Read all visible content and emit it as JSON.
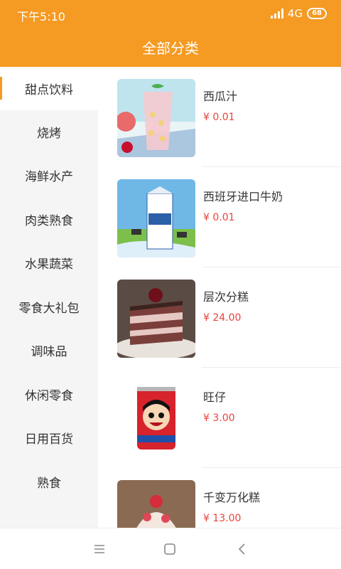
{
  "status_bar": {
    "time": "下午5:10",
    "network": "4G",
    "battery": "68"
  },
  "header": {
    "title": "全部分类"
  },
  "categories": [
    {
      "label": "甜点饮料",
      "active": true
    },
    {
      "label": "烧烤"
    },
    {
      "label": "海鲜水产"
    },
    {
      "label": "肉类熟食"
    },
    {
      "label": "水果蔬菜"
    },
    {
      "label": "零食大礼包"
    },
    {
      "label": "调味品"
    },
    {
      "label": "休闲零食"
    },
    {
      "label": "日用百货"
    },
    {
      "label": "熟食"
    }
  ],
  "products": [
    {
      "name": "西瓜汁",
      "price": "¥ 0.01",
      "image": "watermelon-juice"
    },
    {
      "name": "西班牙进口牛奶",
      "price": "¥ 0.01",
      "image": "milk-carton"
    },
    {
      "name": "层次分糕",
      "price": "¥ 24.00",
      "image": "layer-cake"
    },
    {
      "name": "旺仔",
      "price": "¥ 3.00",
      "image": "wangzai-can"
    },
    {
      "name": "千变万化糕",
      "price": "¥ 13.00",
      "image": "cream-cake"
    }
  ],
  "nav_bar": {
    "icons": [
      "menu-icon",
      "home-icon",
      "back-icon"
    ]
  },
  "colors": {
    "accent": "#f59a23",
    "price": "#e8433a"
  }
}
